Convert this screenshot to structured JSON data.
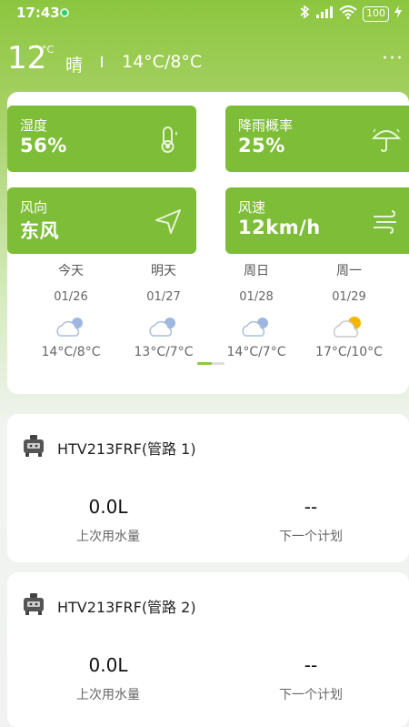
{
  "status_bar": {
    "time": "17:43",
    "battery": "100"
  },
  "header": {
    "current_temp": "12",
    "temp_unit": "°C",
    "condition": "晴",
    "temp_range": "14°C/8°C"
  },
  "tiles": [
    {
      "label": "湿度",
      "value": "56%",
      "icon": "thermometer-icon"
    },
    {
      "label": "降雨概率",
      "value": "25%",
      "icon": "umbrella-icon"
    },
    {
      "label": "风向",
      "value": "东风",
      "icon": "navigation-arrow-icon"
    },
    {
      "label": "风速",
      "value": "12km/h",
      "icon": "wind-icon"
    }
  ],
  "forecast": [
    {
      "day": "今天",
      "date": "01/26",
      "temp": "14°C/8°C",
      "icon": "cloudy-icon"
    },
    {
      "day": "明天",
      "date": "01/27",
      "temp": "13°C/7°C",
      "icon": "cloudy-icon"
    },
    {
      "day": "周日",
      "date": "01/28",
      "temp": "14°C/7°C",
      "icon": "cloudy-icon"
    },
    {
      "day": "周一",
      "date": "01/29",
      "temp": "17°C/10°C",
      "icon": "partly-sunny-icon"
    }
  ],
  "colors": {
    "accent": "#8cc63f",
    "tile": "#7dbd37"
  },
  "devices": [
    {
      "title": "HTV213FRF(管路 1)",
      "last_usage_value": "0.0L",
      "last_usage_label": "上次用水量",
      "next_plan_value": "--",
      "next_plan_label": "下一个计划"
    },
    {
      "title": "HTV213FRF(管路 2)",
      "last_usage_value": "0.0L",
      "last_usage_label": "上次用水量",
      "next_plan_value": "--",
      "next_plan_label": "下一个计划"
    }
  ]
}
